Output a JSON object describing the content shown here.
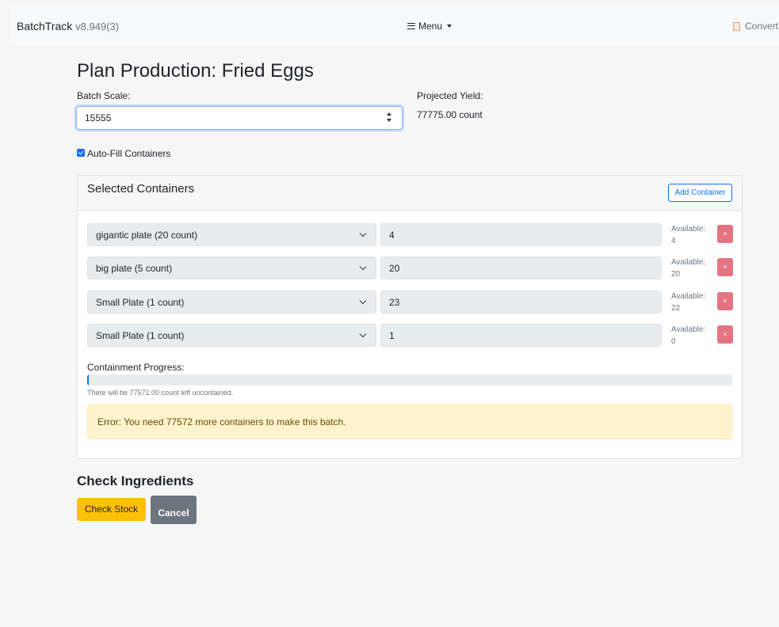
{
  "navbar": {
    "brand": "BatchTrack",
    "version": "v8.949(3)",
    "menu_label": "Menu",
    "convert_label": "Convert"
  },
  "page": {
    "title": "Plan Production: Fried Eggs",
    "batch_scale_label": "Batch Scale:",
    "batch_scale_value": "15555",
    "projected_yield_label": "Projected Yield:",
    "projected_yield_value": "77775.00 count",
    "autofill_label": "Auto-Fill Containers",
    "autofill_checked": true
  },
  "containers": {
    "title": "Selected Containers",
    "add_button": "Add Container",
    "available_label": "Available:",
    "rows": [
      {
        "container": "gigantic plate (20 count)",
        "quantity": "4",
        "available": "4"
      },
      {
        "container": "big plate (5 count)",
        "quantity": "20",
        "available": "20"
      },
      {
        "container": "Small Plate (1 count)",
        "quantity": "23",
        "available": "22"
      },
      {
        "container": "Small Plate (1 count)",
        "quantity": "1",
        "available": "0"
      }
    ],
    "remove_glyph": "×",
    "progress_label": "Containment Progress:",
    "progress_fraction": 0.0026,
    "uncontained_text": "There will be 77571.00 count left uncontained.",
    "error_text": "Error: You need 77572 more containers to make this batch."
  },
  "ingredients": {
    "title": "Check Ingredients",
    "check_stock_button": "Check Stock",
    "cancel_button": "Cancel"
  },
  "colors": {
    "primary": "#0d6efd",
    "warning": "#ffc107",
    "danger": "#e47482",
    "secondary": "#6c757d"
  }
}
